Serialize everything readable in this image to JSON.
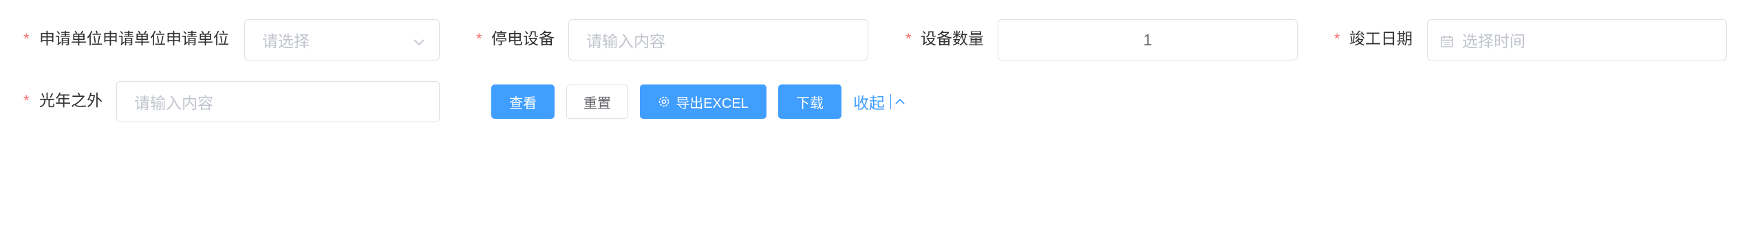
{
  "form": {
    "apply_unit": {
      "required_mark": "*",
      "label": "申请单位申请单位申请单位",
      "placeholder": "请选择",
      "icon": "chevron-down-icon"
    },
    "power_device": {
      "required_mark": "*",
      "label": "停电设备",
      "placeholder": "请输入内容"
    },
    "device_count": {
      "required_mark": "*",
      "label": "设备数量",
      "value": "1"
    },
    "completion_date": {
      "required_mark": "*",
      "label": "竣工日期",
      "placeholder": "选择时间",
      "icon": "calendar-icon"
    },
    "light_year": {
      "required_mark": "*",
      "label": "光年之外",
      "placeholder": "请输入内容"
    }
  },
  "actions": {
    "view_label": "查看",
    "reset_label": "重置",
    "export_label": "导出EXCEL",
    "export_icon": "gear-icon",
    "download_label": "下载",
    "collapse_label": "收起",
    "collapse_icon": "chevron-up-icon"
  },
  "colors": {
    "primary": "#409eff",
    "required": "#f56c6c",
    "border": "#dcdfe6",
    "placeholder": "#c0c4cc",
    "label": "#303133"
  }
}
